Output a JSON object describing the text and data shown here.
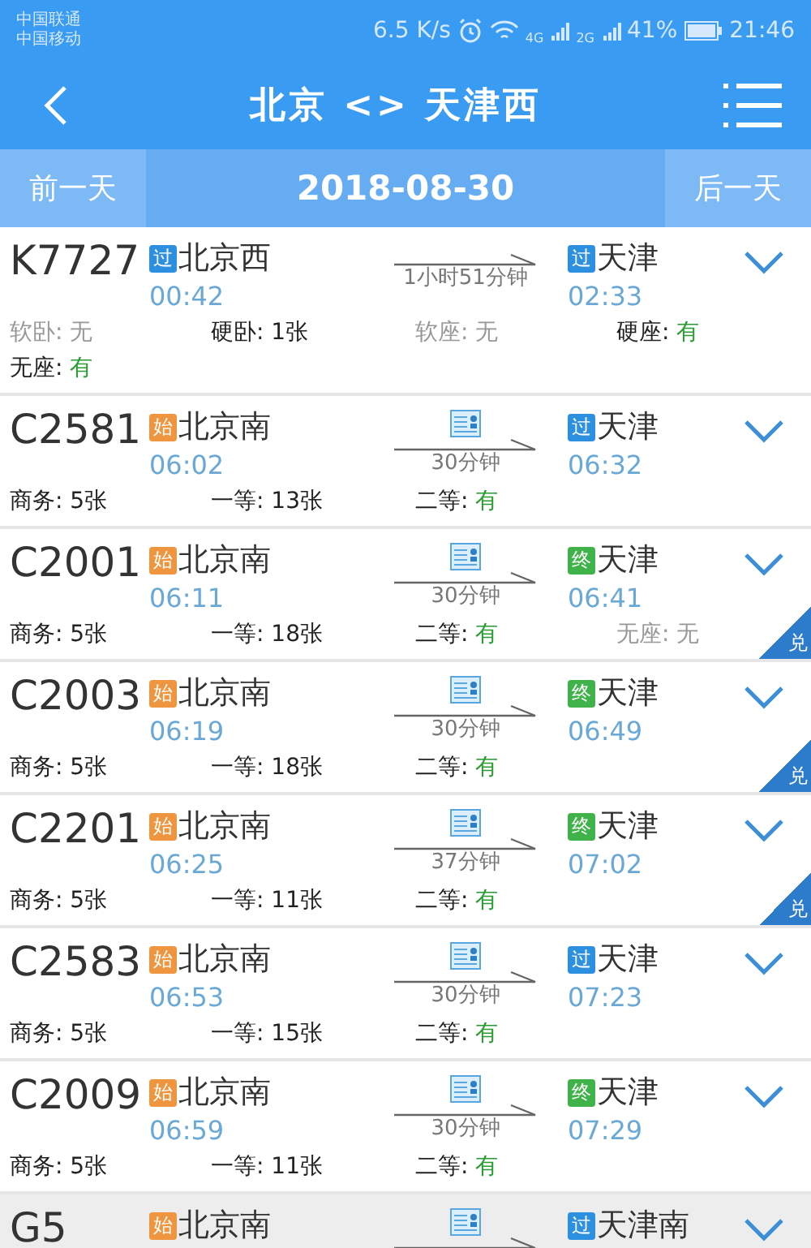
{
  "status_bar": {
    "carriers": [
      "中国联通",
      "中国移动"
    ],
    "speed": "6.5 K/s",
    "network_1": "4G",
    "network_2": "2G",
    "battery": "41%",
    "time": "21:46"
  },
  "header": {
    "title": "北京 <> 天津西"
  },
  "date_bar": {
    "prev": "前一天",
    "date": "2018-08-30",
    "next": "后一天"
  },
  "trains": [
    {
      "number": "K7727",
      "from": {
        "tag": "过",
        "kind": "pass",
        "name": "北京西"
      },
      "depart": "00:42",
      "duration": "1小时51分钟",
      "ticket_icon": false,
      "to": {
        "tag": "过",
        "kind": "pass",
        "name": "天津"
      },
      "arrive": "02:33",
      "exchange": false,
      "highlighted": false,
      "seats": [
        {
          "label": "软卧:",
          "value": "无",
          "kind": "none"
        },
        {
          "label": "硬卧:",
          "value": "1张",
          "kind": "count"
        },
        {
          "label": "软座:",
          "value": "无",
          "kind": "none"
        },
        {
          "label": "硬座:",
          "value": "有",
          "kind": "plenty"
        },
        {
          "label": "无座:",
          "value": "有",
          "kind": "plenty"
        }
      ]
    },
    {
      "number": "C2581",
      "from": {
        "tag": "始",
        "kind": "start",
        "name": "北京南"
      },
      "depart": "06:02",
      "duration": "30分钟",
      "ticket_icon": true,
      "to": {
        "tag": "过",
        "kind": "pass",
        "name": "天津"
      },
      "arrive": "06:32",
      "exchange": false,
      "highlighted": false,
      "seats": [
        {
          "label": "商务:",
          "value": "5张",
          "kind": "count"
        },
        {
          "label": "一等:",
          "value": "13张",
          "kind": "count"
        },
        {
          "label": "二等:",
          "value": "有",
          "kind": "plenty"
        }
      ]
    },
    {
      "number": "C2001",
      "from": {
        "tag": "始",
        "kind": "start",
        "name": "北京南"
      },
      "depart": "06:11",
      "duration": "30分钟",
      "ticket_icon": true,
      "to": {
        "tag": "终",
        "kind": "end",
        "name": "天津"
      },
      "arrive": "06:41",
      "exchange": true,
      "exchange_label": "兑",
      "highlighted": false,
      "seats": [
        {
          "label": "商务:",
          "value": "5张",
          "kind": "count"
        },
        {
          "label": "一等:",
          "value": "18张",
          "kind": "count"
        },
        {
          "label": "二等:",
          "value": "有",
          "kind": "plenty"
        },
        {
          "label": "无座:",
          "value": "无",
          "kind": "none"
        }
      ]
    },
    {
      "number": "C2003",
      "from": {
        "tag": "始",
        "kind": "start",
        "name": "北京南"
      },
      "depart": "06:19",
      "duration": "30分钟",
      "ticket_icon": true,
      "to": {
        "tag": "终",
        "kind": "end",
        "name": "天津"
      },
      "arrive": "06:49",
      "exchange": true,
      "exchange_label": "兑",
      "highlighted": false,
      "seats": [
        {
          "label": "商务:",
          "value": "5张",
          "kind": "count"
        },
        {
          "label": "一等:",
          "value": "18张",
          "kind": "count"
        },
        {
          "label": "二等:",
          "value": "有",
          "kind": "plenty"
        }
      ]
    },
    {
      "number": "C2201",
      "from": {
        "tag": "始",
        "kind": "start",
        "name": "北京南"
      },
      "depart": "06:25",
      "duration": "37分钟",
      "ticket_icon": true,
      "to": {
        "tag": "终",
        "kind": "end",
        "name": "天津"
      },
      "arrive": "07:02",
      "exchange": true,
      "exchange_label": "兑",
      "highlighted": false,
      "seats": [
        {
          "label": "商务:",
          "value": "5张",
          "kind": "count"
        },
        {
          "label": "一等:",
          "value": "11张",
          "kind": "count"
        },
        {
          "label": "二等:",
          "value": "有",
          "kind": "plenty"
        }
      ]
    },
    {
      "number": "C2583",
      "from": {
        "tag": "始",
        "kind": "start",
        "name": "北京南"
      },
      "depart": "06:53",
      "duration": "30分钟",
      "ticket_icon": true,
      "to": {
        "tag": "过",
        "kind": "pass",
        "name": "天津"
      },
      "arrive": "07:23",
      "exchange": false,
      "highlighted": false,
      "seats": [
        {
          "label": "商务:",
          "value": "5张",
          "kind": "count"
        },
        {
          "label": "一等:",
          "value": "15张",
          "kind": "count"
        },
        {
          "label": "二等:",
          "value": "有",
          "kind": "plenty"
        }
      ]
    },
    {
      "number": "C2009",
      "from": {
        "tag": "始",
        "kind": "start",
        "name": "北京南"
      },
      "depart": "06:59",
      "duration": "30分钟",
      "ticket_icon": true,
      "to": {
        "tag": "终",
        "kind": "end",
        "name": "天津"
      },
      "arrive": "07:29",
      "exchange": false,
      "highlighted": false,
      "seats": [
        {
          "label": "商务:",
          "value": "5张",
          "kind": "count"
        },
        {
          "label": "一等:",
          "value": "11张",
          "kind": "count"
        },
        {
          "label": "二等:",
          "value": "有",
          "kind": "plenty"
        }
      ]
    },
    {
      "number": "G5",
      "from": {
        "tag": "始",
        "kind": "start",
        "name": "北京南"
      },
      "ticket_icon": true,
      "to": {
        "tag": "过",
        "kind": "pass",
        "name": "天津南"
      },
      "exchange": false,
      "highlighted": true
    }
  ]
}
